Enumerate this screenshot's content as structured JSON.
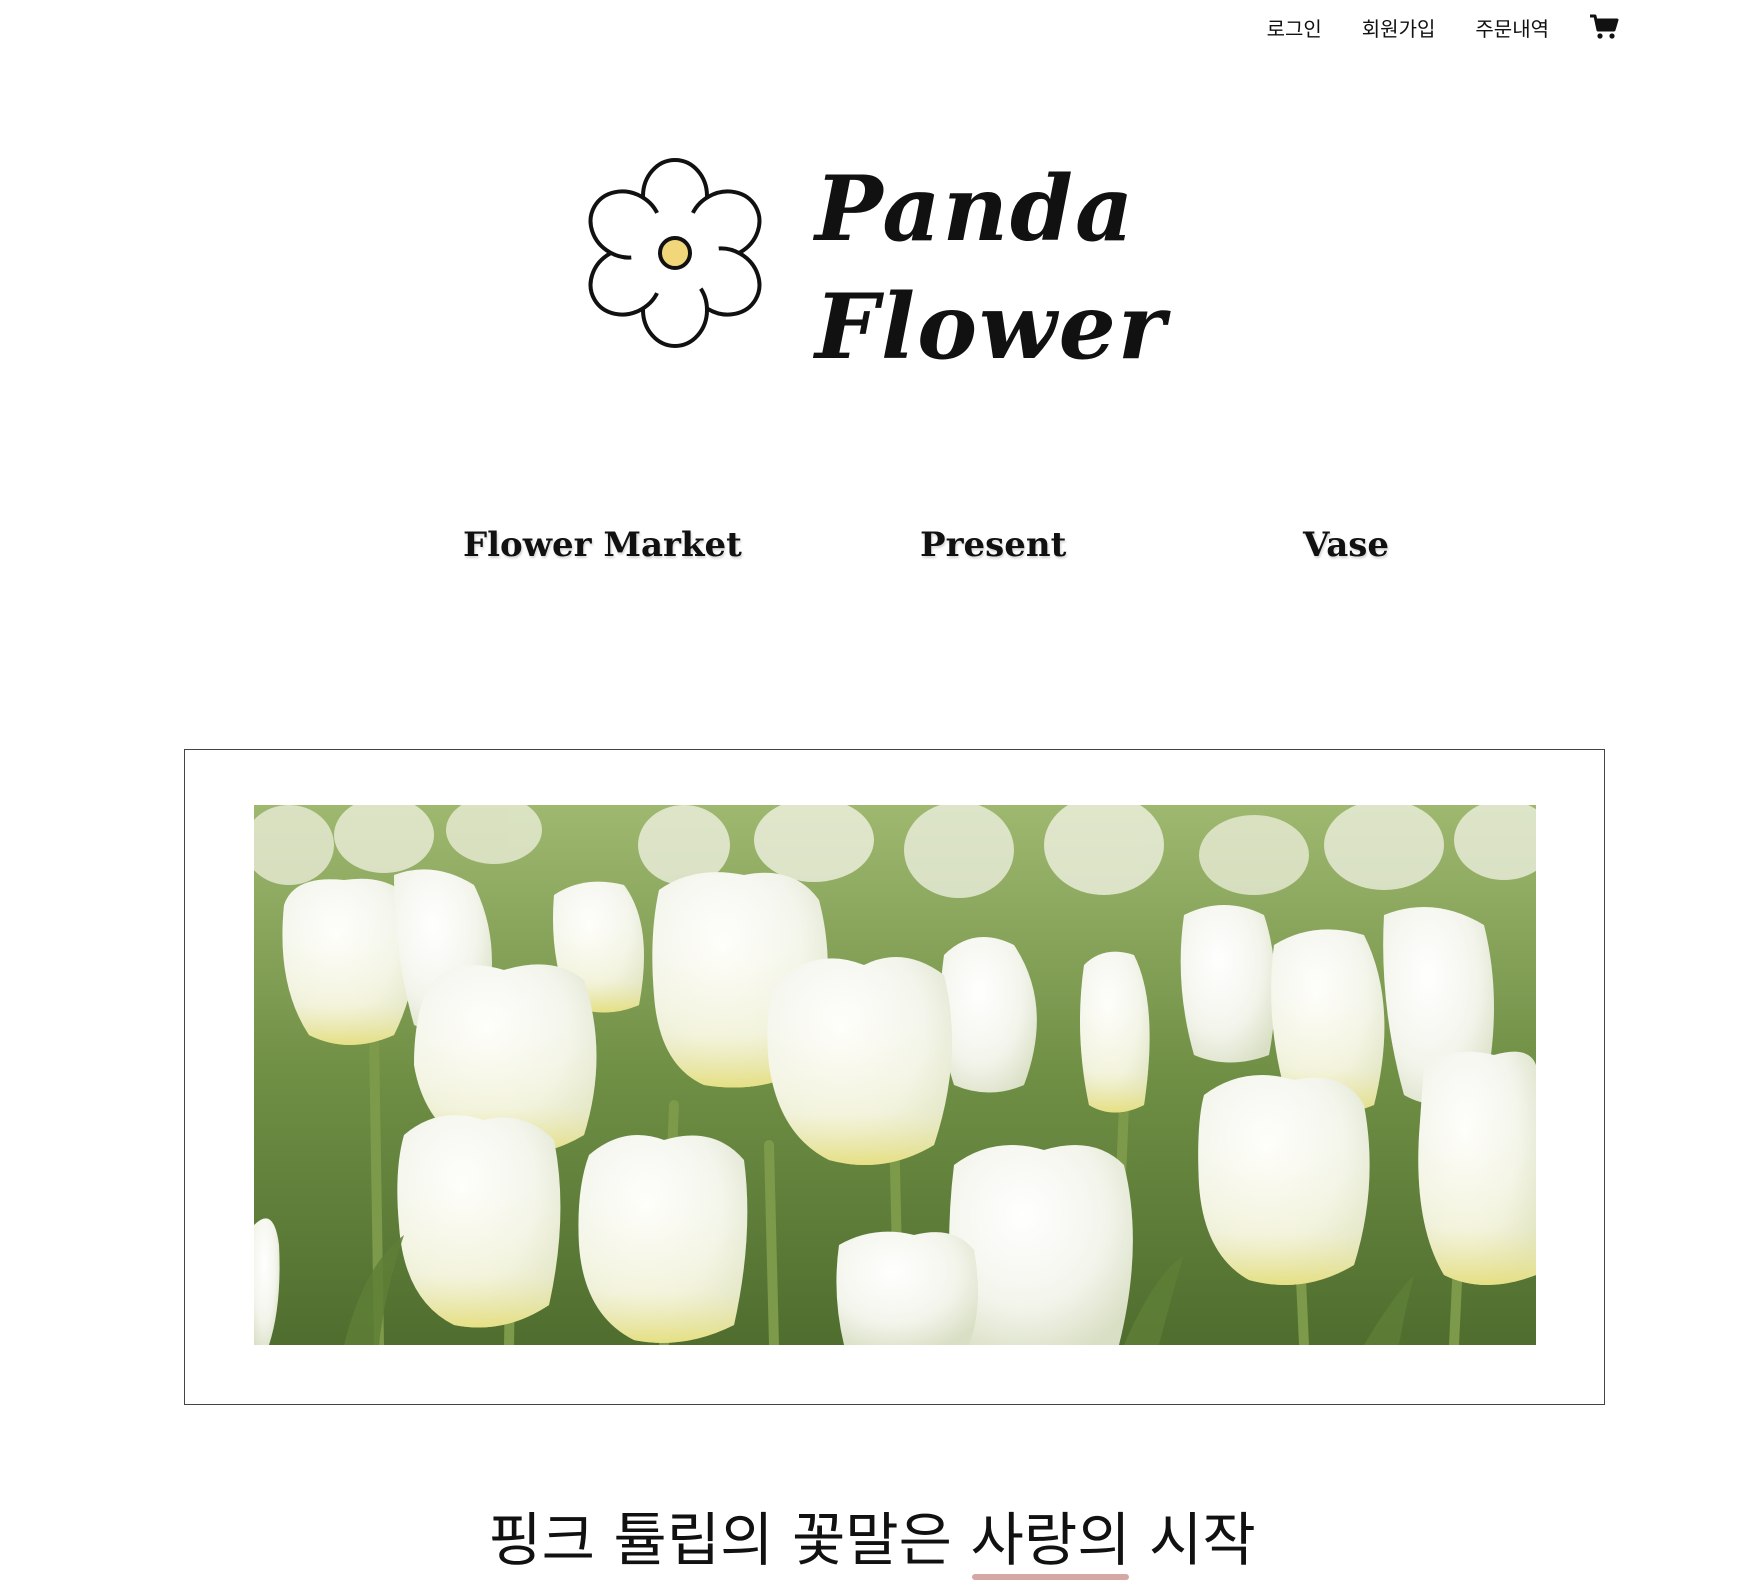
{
  "top_bar": {
    "login": "로그인",
    "signup": "회원가입",
    "orders": "주문내역",
    "cart_icon": "shopping-cart-icon"
  },
  "logo": {
    "line1": "Panda",
    "line2": "Flower",
    "icon": "daisy-flower-icon",
    "center_color": "#f2d77a"
  },
  "nav": {
    "items": [
      {
        "label": "Flower Market"
      },
      {
        "label": "Present"
      },
      {
        "label": "Vase"
      }
    ]
  },
  "hero": {
    "image": "white-tulips-field"
  },
  "headline": {
    "before": "핑크 튤립의 꽃말은 ",
    "highlight": "사랑의",
    "after": " 시작",
    "underline_color": "#d4a8a4"
  }
}
